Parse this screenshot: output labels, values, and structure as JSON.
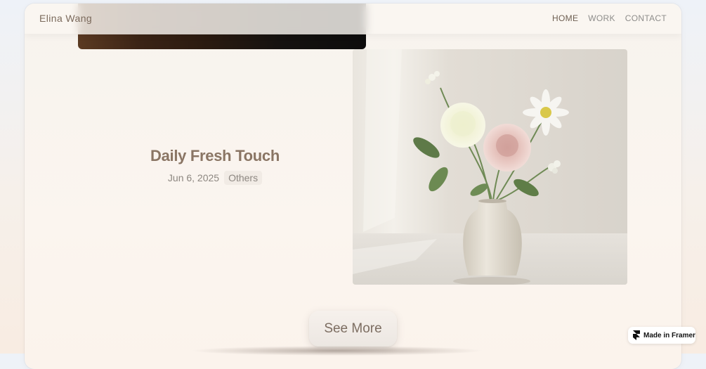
{
  "header": {
    "brand": "Elina Wang",
    "nav": [
      {
        "label": "HOME",
        "active": true
      },
      {
        "label": "WORK",
        "active": false
      },
      {
        "label": "CONTACT",
        "active": false
      }
    ]
  },
  "post": {
    "title": "Daily Fresh Touch",
    "date": "Jun 6, 2025",
    "category": "Others"
  },
  "see_more": {
    "label": "See More"
  },
  "framer_badge": {
    "label": "Made in Framer"
  },
  "colors": {
    "brand_text": "#7b6a5c",
    "title_text": "#8a7564",
    "card_background": "#fbf5ef"
  }
}
